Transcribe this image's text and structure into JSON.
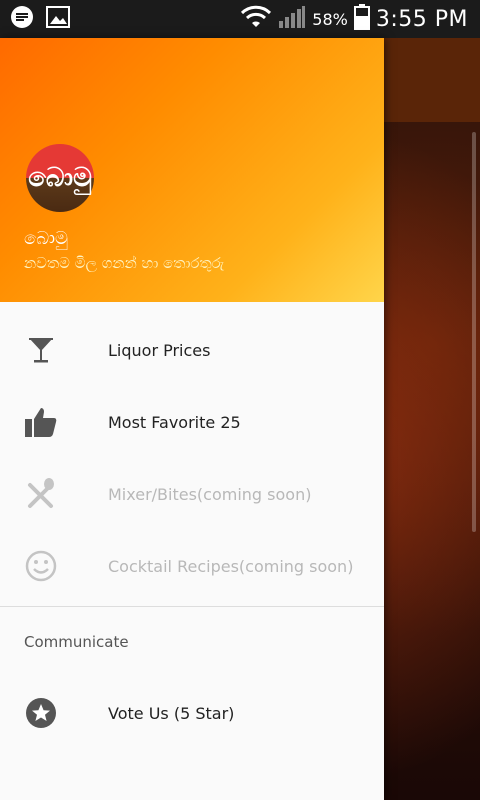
{
  "status_bar": {
    "battery_percent": "58%",
    "time": "3:55 PM"
  },
  "drawer": {
    "header": {
      "avatar_text": "බොමු",
      "title": "බොමු",
      "subtitle": "නවතම මිල ගනන් හා තොරතුරු"
    },
    "menu_items": [
      {
        "label": "Liquor Prices",
        "icon": "cocktail-glass-icon",
        "enabled": true
      },
      {
        "label": "Most Favorite 25",
        "icon": "thumb-up-icon",
        "enabled": true
      },
      {
        "label": "Mixer/Bites(coming soon)",
        "icon": "fork-spoon-icon",
        "enabled": false
      },
      {
        "label": "Cocktail Recipes(coming soon)",
        "icon": "smiley-icon",
        "enabled": false
      }
    ],
    "section_label": "Communicate",
    "communicate_items": [
      {
        "label": "Vote Us (5 Star)",
        "icon": "star-circle-icon",
        "enabled": true
      }
    ]
  },
  "colors": {
    "header_start": "#ff6a00",
    "header_end": "#ffd54a",
    "icon_active": "#555555",
    "icon_disabled": "#c4c4c4"
  }
}
